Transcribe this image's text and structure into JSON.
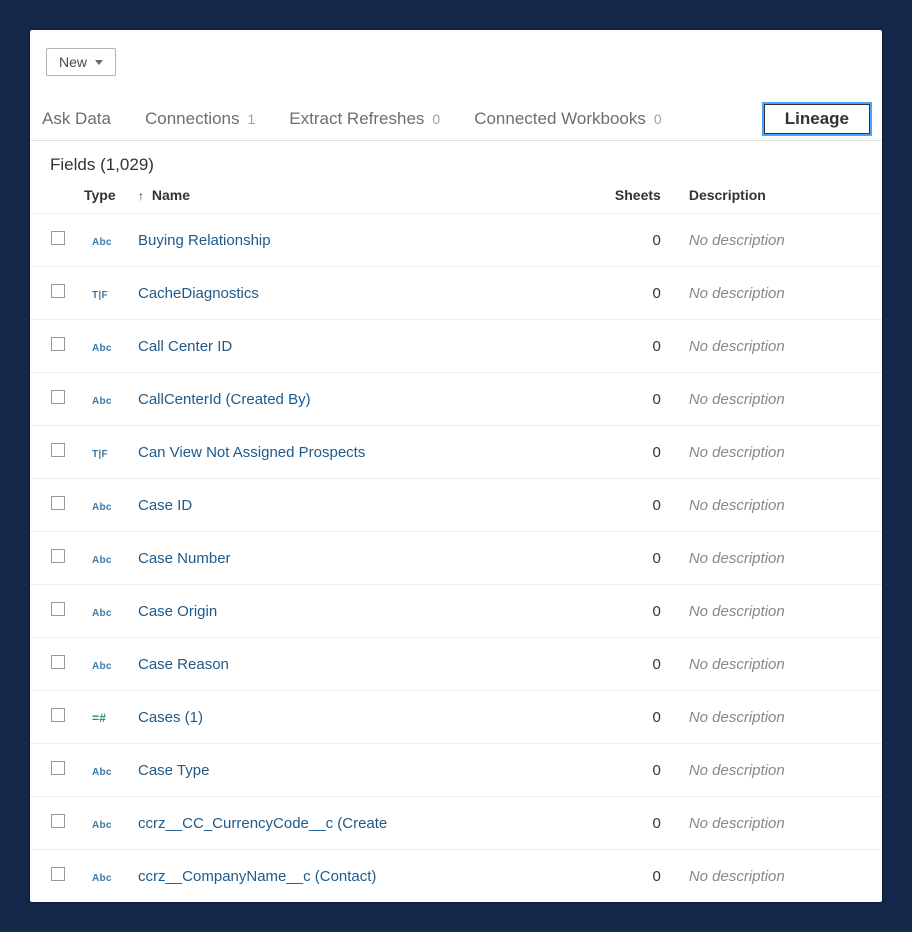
{
  "newButton": {
    "label": "New"
  },
  "tabs": {
    "askData": {
      "label": "Ask Data"
    },
    "connections": {
      "label": "Connections",
      "count": "1"
    },
    "extract": {
      "label": "Extract Refreshes",
      "count": "0"
    },
    "connected": {
      "label": "Connected Workbooks",
      "count": "0"
    },
    "lineage": {
      "label": "Lineage"
    }
  },
  "fieldsHeading": "Fields (1,029)",
  "columns": {
    "type": "Type",
    "name": "Name",
    "sheets": "Sheets",
    "description": "Description"
  },
  "noDescription": "No description",
  "typeIcons": {
    "abc": "Abc",
    "tf": "T|F",
    "num": "=#"
  },
  "rows": [
    {
      "type": "abc",
      "name": "Buying Relationship",
      "sheets": "0"
    },
    {
      "type": "tf",
      "name": "CacheDiagnostics",
      "sheets": "0"
    },
    {
      "type": "abc",
      "name": "Call Center ID",
      "sheets": "0"
    },
    {
      "type": "abc",
      "name": "CallCenterId (Created By)",
      "sheets": "0"
    },
    {
      "type": "tf",
      "name": "Can View Not Assigned Prospects",
      "sheets": "0"
    },
    {
      "type": "abc",
      "name": "Case ID",
      "sheets": "0"
    },
    {
      "type": "abc",
      "name": "Case Number",
      "sheets": "0"
    },
    {
      "type": "abc",
      "name": "Case Origin",
      "sheets": "0"
    },
    {
      "type": "abc",
      "name": "Case Reason",
      "sheets": "0"
    },
    {
      "type": "num",
      "name": "Cases (1)",
      "sheets": "0"
    },
    {
      "type": "abc",
      "name": "Case Type",
      "sheets": "0"
    },
    {
      "type": "abc",
      "name": "ccrz__CC_CurrencyCode__c (Create",
      "sheets": "0"
    },
    {
      "type": "abc",
      "name": "ccrz__CompanyName__c (Contact)",
      "sheets": "0"
    }
  ]
}
